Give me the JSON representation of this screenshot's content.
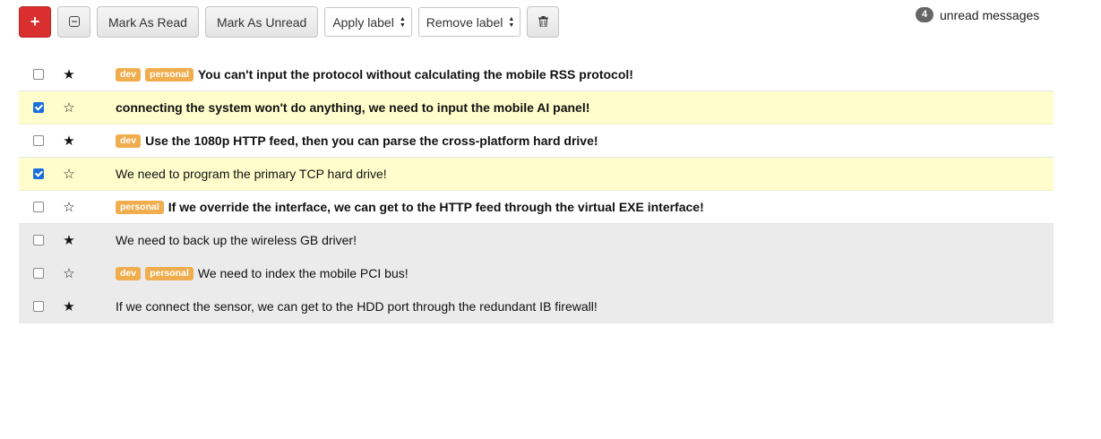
{
  "toolbar": {
    "add_label": "+",
    "minus_label": "⊖",
    "mark_read_label": "Mark As Read",
    "mark_unread_label": "Mark As Unread",
    "apply_label": "Apply label",
    "remove_label": "Remove label",
    "trash_icon": "trash-icon"
  },
  "unread": {
    "count": "4",
    "text": "unread messages"
  },
  "messages": [
    {
      "checked": false,
      "starred": true,
      "read": false,
      "labels": [
        "dev",
        "personal"
      ],
      "subject": "You can't input the protocol without calculating the mobile RSS protocol!"
    },
    {
      "checked": true,
      "starred": false,
      "read": false,
      "labels": [],
      "subject": "connecting the system won't do anything, we need to input the mobile AI panel!"
    },
    {
      "checked": false,
      "starred": true,
      "read": false,
      "labels": [
        "dev"
      ],
      "subject": "Use the 1080p HTTP feed, then you can parse the cross-platform hard drive!"
    },
    {
      "checked": true,
      "starred": false,
      "read": true,
      "labels": [],
      "subject": "We need to program the primary TCP hard drive!"
    },
    {
      "checked": false,
      "starred": false,
      "read": false,
      "labels": [
        "personal"
      ],
      "subject": "If we override the interface, we can get to the HTTP feed through the virtual EXE interface!"
    },
    {
      "checked": false,
      "starred": true,
      "read": true,
      "labels": [],
      "subject": "We need to back up the wireless GB driver!"
    },
    {
      "checked": false,
      "starred": false,
      "read": true,
      "labels": [
        "dev",
        "personal"
      ],
      "subject": "We need to index the mobile PCI bus!"
    },
    {
      "checked": false,
      "starred": true,
      "read": true,
      "labels": [],
      "subject": "If we connect the sensor, we can get to the HDD port through the redundant IB firewall!"
    }
  ],
  "colors": {
    "add_button": "#d9302f",
    "label": "#f0ad4e",
    "selected_row": "#fefdcb",
    "read_row": "#ebebeb",
    "checkbox_checked": "#1a6fdc"
  }
}
